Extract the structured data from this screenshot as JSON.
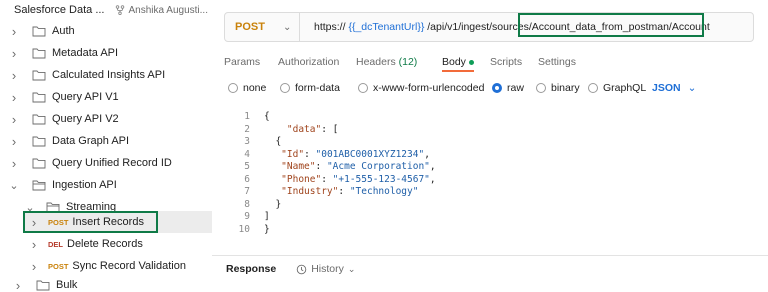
{
  "workspace": {
    "name": "Salesforce Data ...",
    "user": "Anshika Augusti..."
  },
  "tree": [
    {
      "label": "Auth",
      "expanded": false
    },
    {
      "label": "Metadata API",
      "expanded": false
    },
    {
      "label": "Calculated Insights API",
      "expanded": false
    },
    {
      "label": "Query API V1",
      "expanded": false
    },
    {
      "label": "Query API V2",
      "expanded": false
    },
    {
      "label": "Data Graph API",
      "expanded": false
    },
    {
      "label": "Query Unified Record ID",
      "expanded": false
    },
    {
      "label": "Ingestion API",
      "expanded": true
    },
    {
      "label": "Streaming",
      "expanded": true
    },
    {
      "method": "POST",
      "label": "Insert Records",
      "selected": true
    },
    {
      "method": "DEL",
      "label": "Delete Records"
    },
    {
      "method": "POST",
      "label": "Sync Record Validation"
    },
    {
      "label": "Bulk",
      "expanded": false
    }
  ],
  "request": {
    "method": "POST",
    "url_prefix": "https://",
    "url_var": "{{_dcTenantUrl}}",
    "url_path": "/api/v1/ingest/sources",
    "url_highlight": "/Account_data_from_postman/Account"
  },
  "tabs": {
    "params": "Params",
    "authorization": "Authorization",
    "headers": "Headers",
    "headers_count": "(12)",
    "body": "Body",
    "scripts": "Scripts",
    "settings": "Settings"
  },
  "body_options": {
    "none": "none",
    "form_data": "form-data",
    "urlencoded": "x-www-form-urlencoded",
    "raw": "raw",
    "binary": "binary",
    "graphql": "GraphQL",
    "format": "JSON"
  },
  "code_lines": [
    {
      "n": "1",
      "parts": [
        [
          "p",
          "{"
        ]
      ]
    },
    {
      "n": "2",
      "parts": [
        [
          "p",
          "    "
        ],
        [
          "k",
          "\"data\""
        ],
        [
          "p",
          ": ["
        ]
      ]
    },
    {
      "n": "3",
      "parts": [
        [
          "p",
          "  {"
        ]
      ]
    },
    {
      "n": "4",
      "parts": [
        [
          "p",
          "   "
        ],
        [
          "k",
          "\"Id\""
        ],
        [
          "p",
          ": "
        ],
        [
          "s",
          "\"001ABC0001XYZ1234\""
        ],
        [
          "p",
          ","
        ]
      ]
    },
    {
      "n": "5",
      "parts": [
        [
          "p",
          "   "
        ],
        [
          "k",
          "\"Name\""
        ],
        [
          "p",
          ": "
        ],
        [
          "s",
          "\"Acme Corporation\""
        ],
        [
          "p",
          ","
        ]
      ]
    },
    {
      "n": "6",
      "parts": [
        [
          "p",
          "   "
        ],
        [
          "k",
          "\"Phone\""
        ],
        [
          "p",
          ": "
        ],
        [
          "s",
          "\"+1-555-123-4567\""
        ],
        [
          "p",
          ","
        ]
      ]
    },
    {
      "n": "7",
      "parts": [
        [
          "p",
          "   "
        ],
        [
          "k",
          "\"Industry\""
        ],
        [
          "p",
          ": "
        ],
        [
          "s",
          "\"Technology\""
        ]
      ]
    },
    {
      "n": "8",
      "parts": [
        [
          "p",
          "  }"
        ]
      ]
    },
    {
      "n": "9",
      "parts": [
        [
          "p",
          "]"
        ]
      ]
    },
    {
      "n": "10",
      "parts": [
        [
          "p",
          "}"
        ]
      ]
    }
  ],
  "response": {
    "label": "Response",
    "history": "History"
  },
  "colors": {
    "post": "#c9820b",
    "del": "#b63a2b",
    "accent": "#f26b3a",
    "highlight": "#0f7a47",
    "link": "#1f6fd6"
  }
}
